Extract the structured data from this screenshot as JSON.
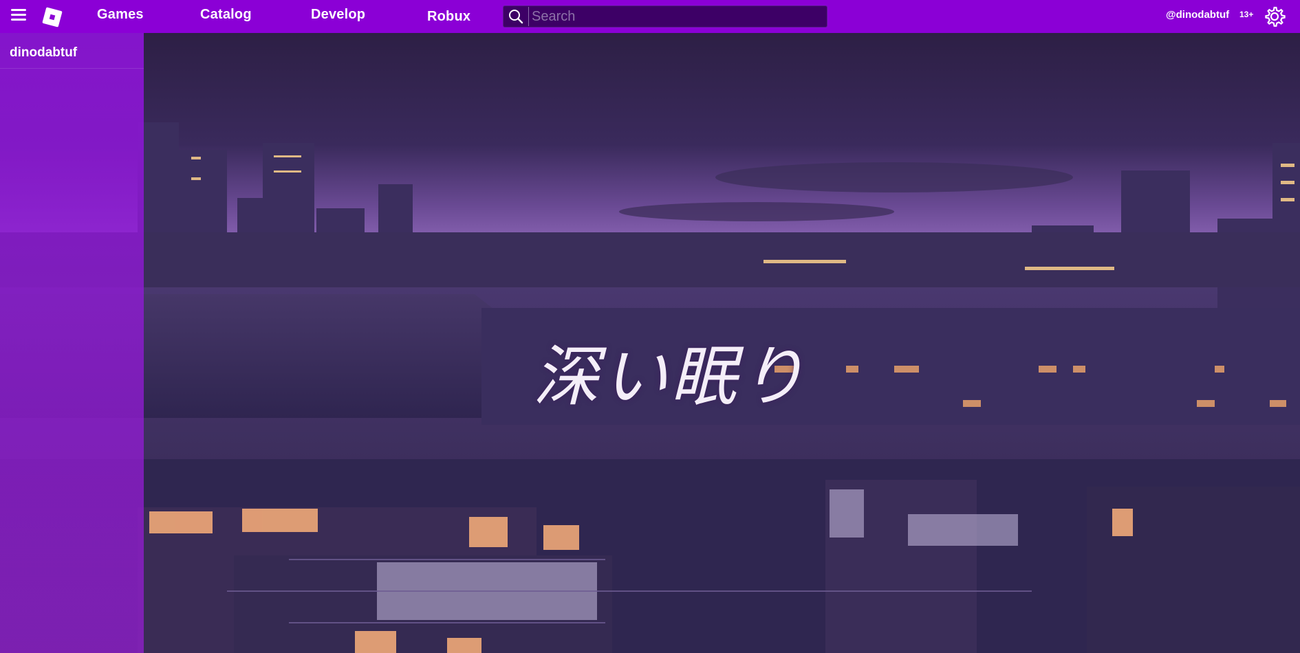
{
  "topbar": {
    "nav": {
      "games": "Games",
      "catalog": "Catalog",
      "develop": "Develop",
      "robux": "Robux"
    },
    "search": {
      "placeholder": "Search",
      "value": ""
    },
    "username": "@dinodabtuf",
    "age_badge": "13+",
    "icons": {
      "menu": "hamburger-menu-icon",
      "logo": "roblox-logo",
      "search": "search-icon",
      "settings": "gear-icon"
    }
  },
  "sidebar": {
    "username": "dinodabtuf"
  },
  "background": {
    "title_text": "深い眠り"
  },
  "colors": {
    "topbar": "#8b00d6",
    "search_bg": "#3d0066",
    "sidebar": "#8c14d7",
    "text": "#ffffff"
  }
}
